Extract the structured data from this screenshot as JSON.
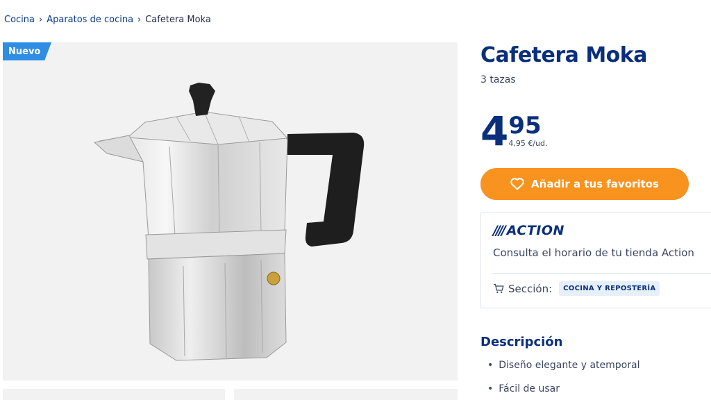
{
  "breadcrumb": {
    "items": [
      "Cocina",
      "Aparatos de cocina",
      "Cafetera Moka"
    ]
  },
  "gallery": {
    "badge": "Nuevo",
    "image_alt": "Cafetera Moka de aluminio"
  },
  "product": {
    "title": "Cafetera Moka",
    "subtitle": "3 tazas",
    "price_int": "4",
    "price_dec": "95",
    "unit_price": "4,95 €/ud."
  },
  "actions": {
    "favorite_label": "Añadir a tus favoritos"
  },
  "store": {
    "brand": "ACTION",
    "hours_text": "Consulta el horario de tu tienda Action",
    "section_label": "Sección:",
    "section_value": "COCINA Y REPOSTERÍA"
  },
  "description": {
    "title": "Descripción",
    "bullets": [
      "Diseño elegante y atemporal",
      "Fácil de usar"
    ]
  },
  "colors": {
    "brand_blue": "#0a2f7c",
    "accent_orange": "#f7931e",
    "badge_blue": "#2f8de4"
  }
}
